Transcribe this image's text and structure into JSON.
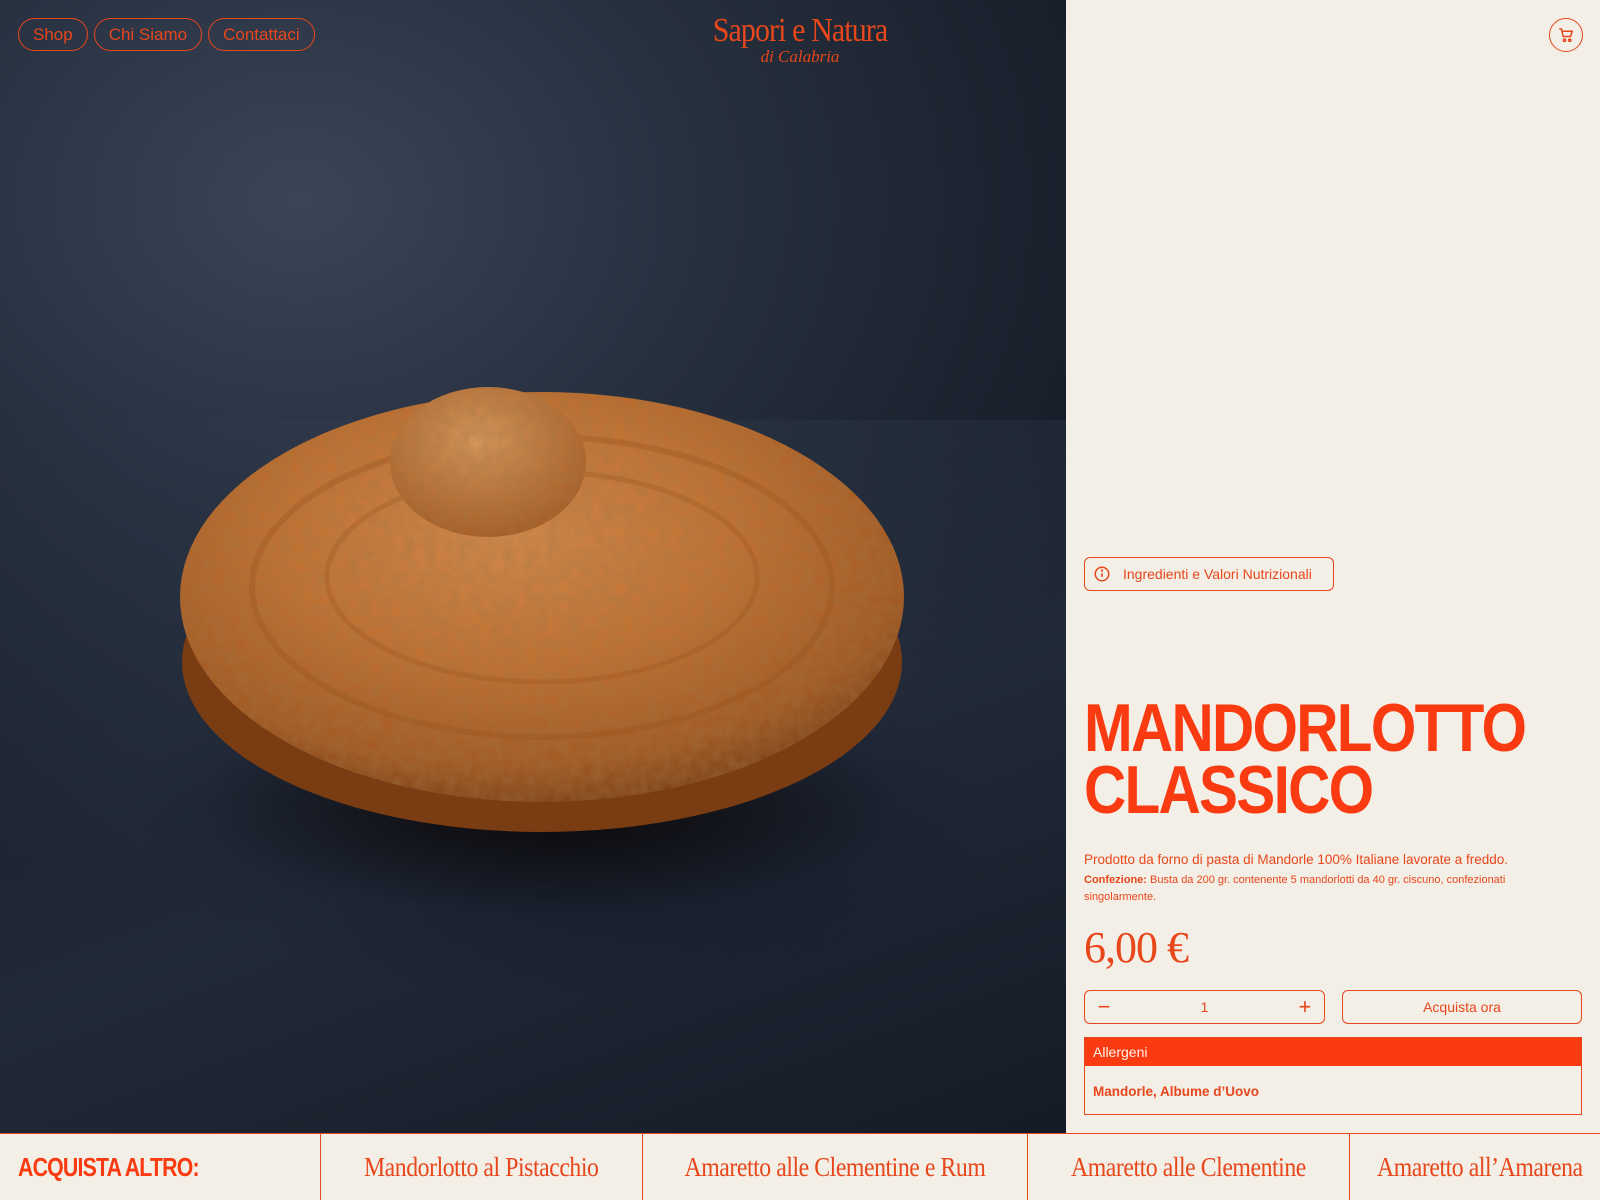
{
  "brand": {
    "name": "Sapori e Natura",
    "tagline": "di Calabria"
  },
  "nav": {
    "items": [
      "Shop",
      "Chi Siamo",
      "Contattaci"
    ]
  },
  "cart": {
    "icon": "cart-icon"
  },
  "product": {
    "info_button": "Ingredienti e Valori Nutrizionali",
    "title_line1": "Mandorlotto",
    "title_line2": "Classico",
    "description": "Prodotto da forno di pasta di Mandorle 100% Italiane lavorate a freddo.",
    "packaging_label": "Confezione:",
    "packaging_text": " Busta da 200 gr. contenente 5 mandorlotti da 40 gr. ciscuno, confezionati singolarmente.",
    "price": "6,00 €",
    "quantity": "1",
    "minus": "−",
    "plus": "+",
    "buy_label": "Acquista ora",
    "allergens_title": "Allergeni",
    "allergens_value": "Mandorle, Albume d’Uovo"
  },
  "more": {
    "label": "ACQUISTA ALTRO:",
    "items": [
      "Mandorlotto al Pistacchio",
      "Amaretto alle Clementine e Rum",
      "Amaretto alle Clementine",
      "Amaretto all’Amarena"
    ]
  },
  "colors": {
    "accent": "#fa3a10",
    "text": "#e8461b",
    "background": "#f4efe6"
  }
}
